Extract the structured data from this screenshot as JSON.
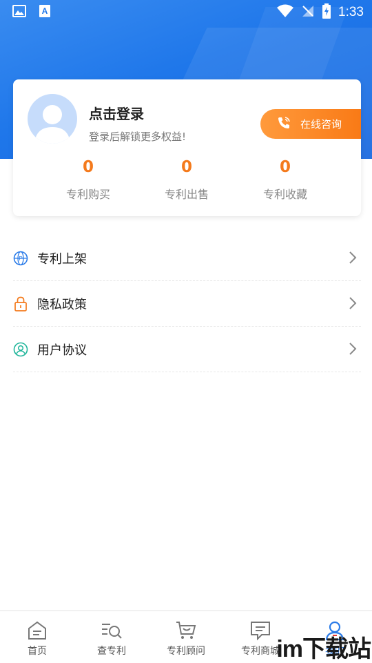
{
  "status_bar": {
    "time": "1:33",
    "icons": [
      "image-icon",
      "app-a-icon",
      "wifi-icon",
      "no-signal-icon",
      "battery-charging-icon"
    ]
  },
  "profile": {
    "login_title": "点击登录",
    "login_subtitle": "登录后解锁更多权益!",
    "consult_button": "在线咨询",
    "stats": [
      {
        "value": "0",
        "label": "专利购买"
      },
      {
        "value": "0",
        "label": "专利出售"
      },
      {
        "value": "0",
        "label": "专利收藏"
      }
    ]
  },
  "menu": [
    {
      "label": "专利上架",
      "icon": "globe-p-icon"
    },
    {
      "label": "隐私政策",
      "icon": "lock-icon"
    },
    {
      "label": "用户协议",
      "icon": "user-circle-icon"
    }
  ],
  "tabbar": [
    {
      "label": "首页",
      "icon": "home-icon"
    },
    {
      "label": "查专利",
      "icon": "search-list-icon"
    },
    {
      "label": "专利顾问",
      "icon": "cart-icon"
    },
    {
      "label": "专利商城",
      "icon": "message-icon"
    },
    {
      "label": "我的",
      "icon": "user-icon",
      "active": true
    }
  ],
  "watermark": "im下载站",
  "colors": {
    "brand_blue": "#1f77ea",
    "accent_orange": "#f47a1c",
    "consult_gradient_start": "#ff9a3c",
    "consult_gradient_end": "#f97a16"
  }
}
